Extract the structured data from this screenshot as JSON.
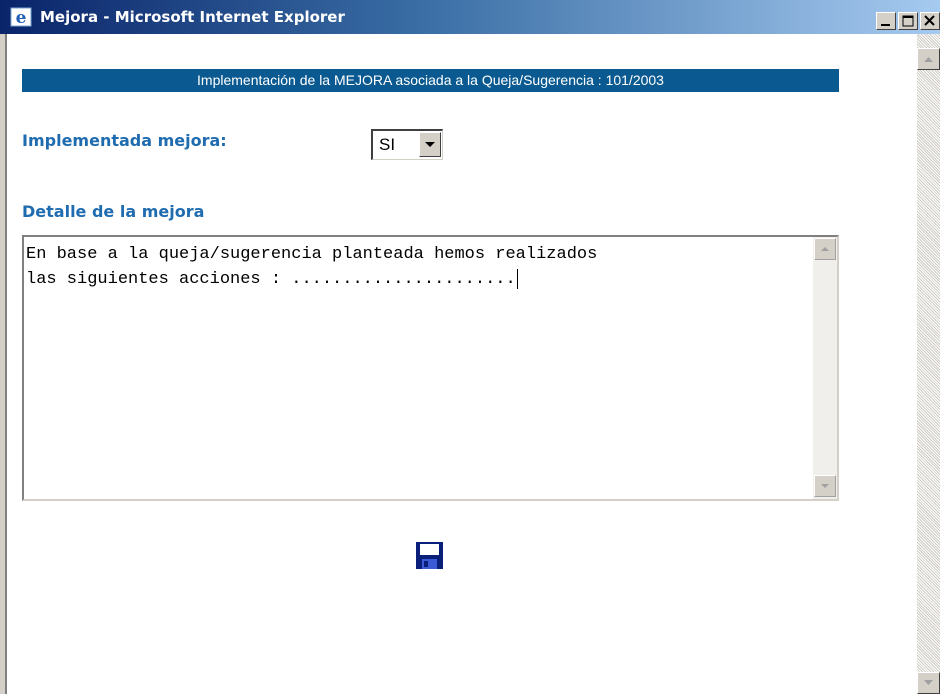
{
  "window": {
    "title": "Mejora - Microsoft Internet Explorer",
    "controls": {
      "minimize": "minimize-icon",
      "restore": "restore-icon",
      "close": "close-icon"
    }
  },
  "page": {
    "header": "Implementación de la MEJORA asociada a la Queja/Sugerencia : 101/2003",
    "implemented_label": "Implementada mejora:",
    "implemented_select": {
      "value": "SI"
    },
    "detail_label": "Detalle de la mejora",
    "detail_text": "En base a la queja/sugerencia planteada hemos realizados\nlas siguientes acciones : ......................",
    "save_icon": "floppy-disk-icon"
  },
  "colors": {
    "header_bar": "#0a5a91",
    "label_text": "#1f6cb0",
    "titlebar_start": "#0a246a"
  }
}
